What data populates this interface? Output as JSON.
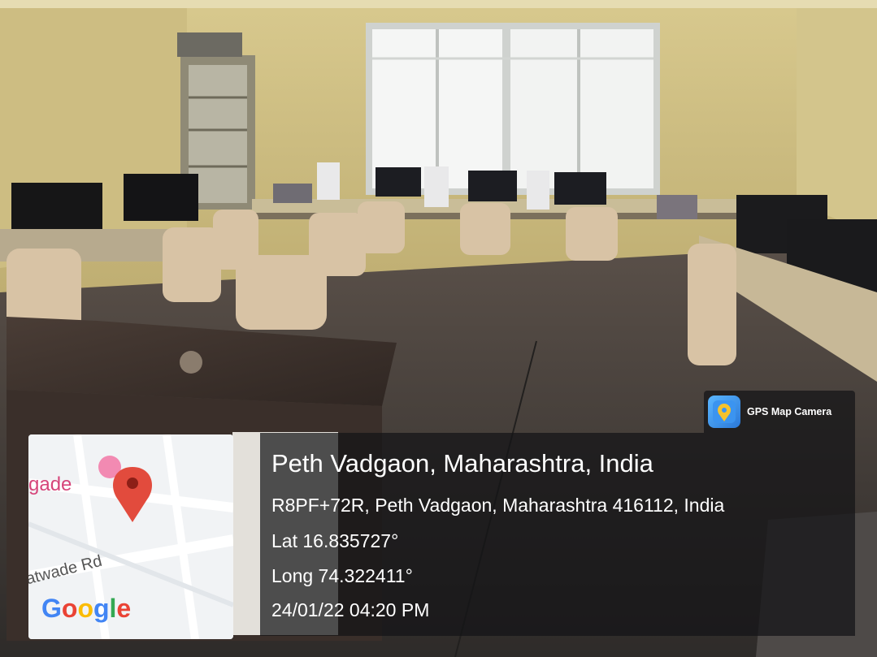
{
  "badge": {
    "label": "GPS Map Camera",
    "icon": "gps-map-camera-icon"
  },
  "location": {
    "title": "Peth Vadgaon, Maharashtra, India",
    "address": "R8PF+72R, Peth Vadgaon, Maharashtra 416112, India",
    "lat": "Lat 16.835727°",
    "long": "Long 74.322411°",
    "datetime": "24/01/22 04:20 PM"
  },
  "map": {
    "place_label": "gade",
    "road_label": "atwade Rd",
    "logo": "Google",
    "marker_color": "#e24b3d"
  }
}
